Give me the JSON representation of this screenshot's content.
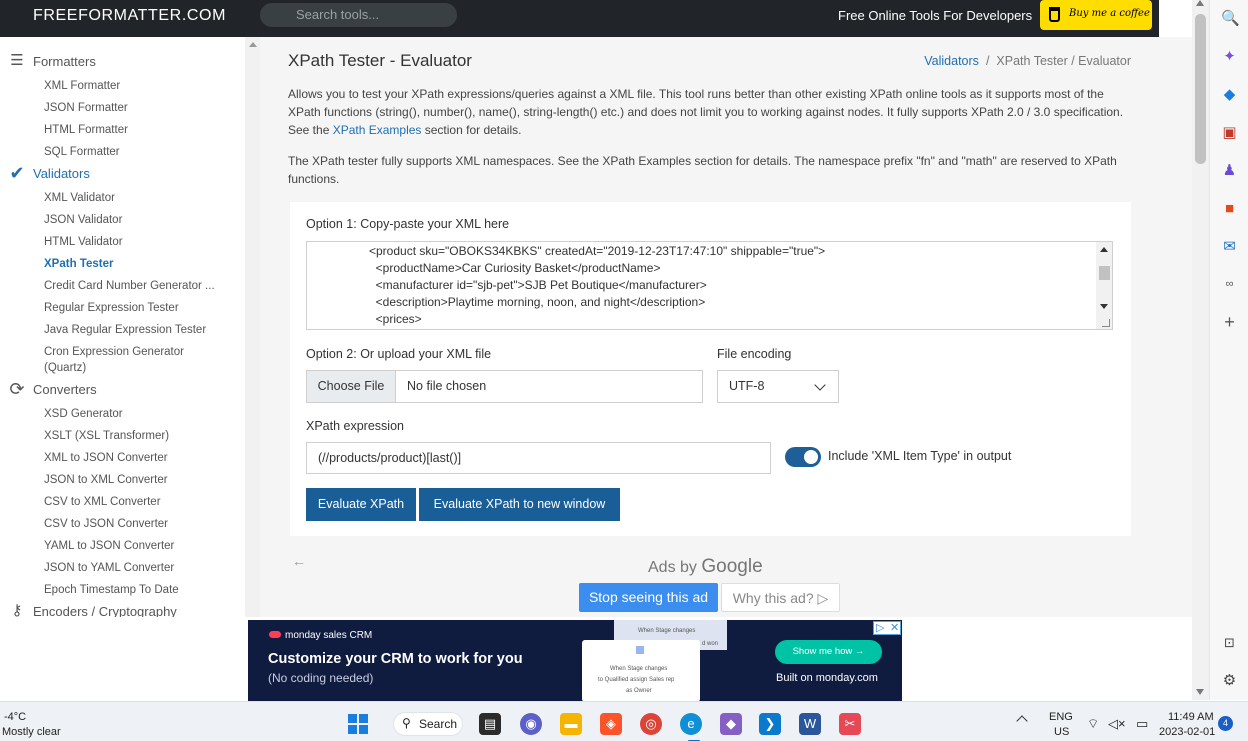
{
  "header": {
    "logo": "FREEFORMATTER.COM",
    "search_placeholder": "Search tools...",
    "tagline": "Free Online Tools For Developers",
    "coffee_label": "Buy me a coffee"
  },
  "nav": {
    "sections": [
      {
        "label": "Formatters",
        "items": [
          "XML Formatter",
          "JSON Formatter",
          "HTML Formatter",
          "SQL Formatter"
        ]
      },
      {
        "label": "Validators",
        "items": [
          "XML Validator",
          "JSON Validator",
          "HTML Validator",
          "XPath Tester",
          "Credit Card Number Generator ...",
          "Regular Expression Tester",
          "Java Regular Expression Tester",
          "Cron Expression Generator (Quartz)"
        ]
      },
      {
        "label": "Converters",
        "items": [
          "XSD Generator",
          "XSLT (XSL Transformer)",
          "XML to JSON Converter",
          "JSON to XML Converter",
          "CSV to XML Converter",
          "CSV to JSON Converter",
          "YAML to JSON Converter",
          "JSON to YAML Converter",
          "Epoch Timestamp To Date"
        ]
      },
      {
        "label": "Encoders / Cryptography",
        "items": []
      }
    ],
    "active_section": "Validators",
    "active_item": "XPath Tester"
  },
  "page": {
    "title": "XPath Tester - Evaluator",
    "breadcrumb_link": "Validators",
    "breadcrumb_current": "XPath Tester / Evaluator",
    "desc1_part1": "Allows you to test your XPath expressions/queries against a XML file. This tool runs better than other existing XPath online tools as it supports most of the XPath functions (string(), number(), name(), string-length() etc.) and does not limit you to working against nodes. It fully supports XPath 2.0 / 3.0 specification. See the ",
    "desc1_link": "XPath Examples",
    "desc1_part2": " section for details.",
    "desc2": "The XPath tester fully supports XML namespaces. See the XPath Examples section for details. The namespace prefix \"fn\" and \"math\" are reserved to XPath functions."
  },
  "form": {
    "option1_label": "Option 1: Copy-paste your XML here",
    "xml_lines": [
      "<product sku=\"OBOKS34KBKS\" createdAt=\"2019-12-23T17:47:10\" shippable=\"true\">",
      "  <productName>Car Curiosity Basket</productName>",
      "  <manufacturer id=\"sjb-pet\">SJB Pet Boutique</manufacturer>",
      "  <description>Playtime morning, noon, and night</description>",
      "  <prices>"
    ],
    "option2_label": "Option 2: Or upload your XML file",
    "choose_file": "Choose File",
    "no_file": "No file chosen",
    "encoding_label": "File encoding",
    "encoding_value": "UTF-8",
    "xpath_label": "XPath expression",
    "xpath_value": "(//products/product)[last()]",
    "toggle_label": "Include 'XML Item Type' in output",
    "toggle_on": true,
    "evaluate_label": "Evaluate XPath",
    "evaluate_new_label": "Evaluate XPath to new window"
  },
  "ads": {
    "ads_by": "Ads by",
    "google": "Google",
    "stop": "Stop seeing this ad",
    "why": "Why this ad? ▷"
  },
  "banner": {
    "brand": "monday sales CRM",
    "headline": "Customize your CRM to work for you",
    "sub": "(No coding needed)",
    "card_top": "When Stage changes",
    "card_won": "d won",
    "card_line1": "When Stage changes",
    "card_line2": "to Qualified assign Sales rep",
    "card_line3": "as Owner",
    "cta": "Show me how →",
    "built_on": "Built on monday.com"
  },
  "taskbar": {
    "temp": "-4°C",
    "weather": "Mostly clear",
    "search": "Search",
    "lang1": "ENG",
    "lang2": "US",
    "time": "11:49 AM",
    "date": "2023-02-01",
    "notifications": "4"
  },
  "colors": {
    "header_bg": "#212529",
    "accent": "#1f6fb2",
    "button": "#1a5e98",
    "coffee": "#ffdd00"
  }
}
